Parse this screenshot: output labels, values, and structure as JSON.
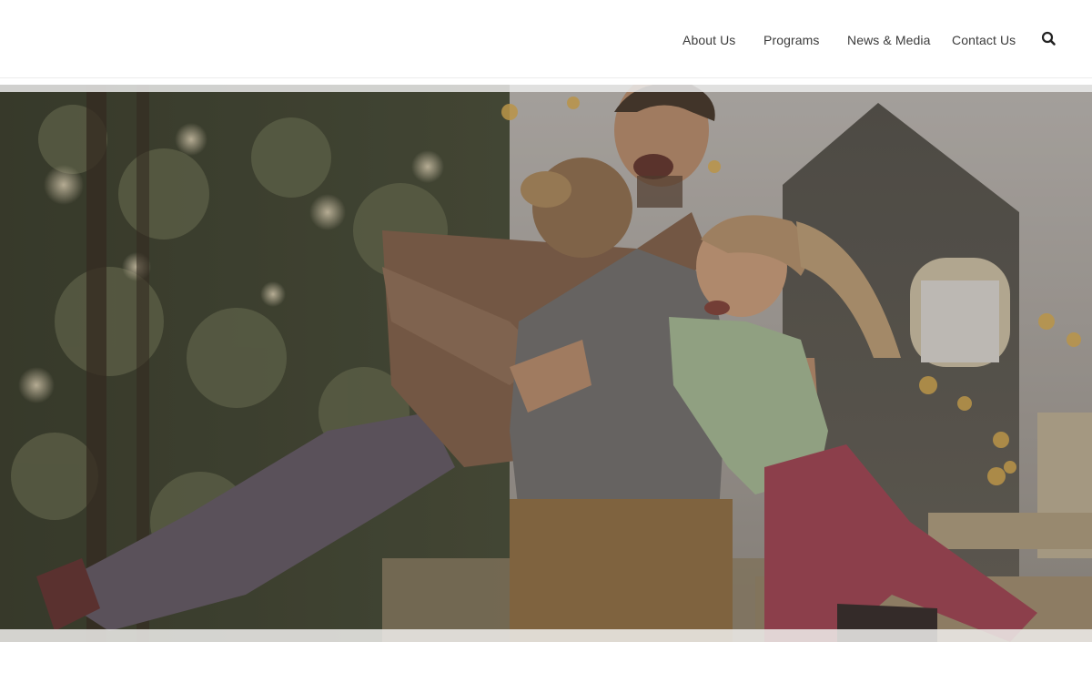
{
  "nav": {
    "items": [
      {
        "label": "About Us"
      },
      {
        "label": "Programs"
      },
      {
        "label": "News & Media"
      },
      {
        "label": "Contact Us"
      }
    ],
    "search_icon": "search-icon"
  },
  "hero": {
    "photo_subject": "",
    "colors": {
      "overlay": "#5a4f45"
    }
  }
}
